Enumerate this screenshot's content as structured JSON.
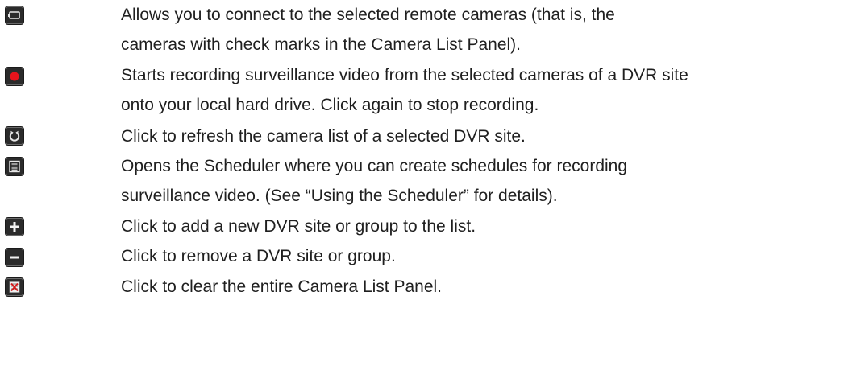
{
  "items": [
    {
      "icon": "connect-camera-icon",
      "line1": "Allows you to connect to the selected remote cameras (that is, the",
      "line2": "cameras with check marks in the Camera List Panel)."
    },
    {
      "icon": "record-icon",
      "line1": "Starts recording surveillance video from the selected cameras of a DVR site",
      "line2": "onto your local hard drive. Click again to stop recording."
    },
    {
      "icon": "refresh-icon",
      "line1": "Click to refresh the camera list of a selected DVR site."
    },
    {
      "icon": "scheduler-icon",
      "line1": "Opens the Scheduler where you can create schedules for recording",
      "line2": "surveillance video. (See “Using the Scheduler” for details)."
    },
    {
      "icon": "add-icon",
      "line1": "Click to add a new DVR site or group to the list."
    },
    {
      "icon": "remove-icon",
      "line1": "Click to remove a DVR site or group."
    },
    {
      "icon": "clear-list-icon",
      "line1": "Click to clear the entire Camera List Panel."
    }
  ],
  "colors": {
    "record_red": "#e8141c",
    "clear_red": "#d21a1a",
    "icon_bg": "#2b2b2b"
  }
}
